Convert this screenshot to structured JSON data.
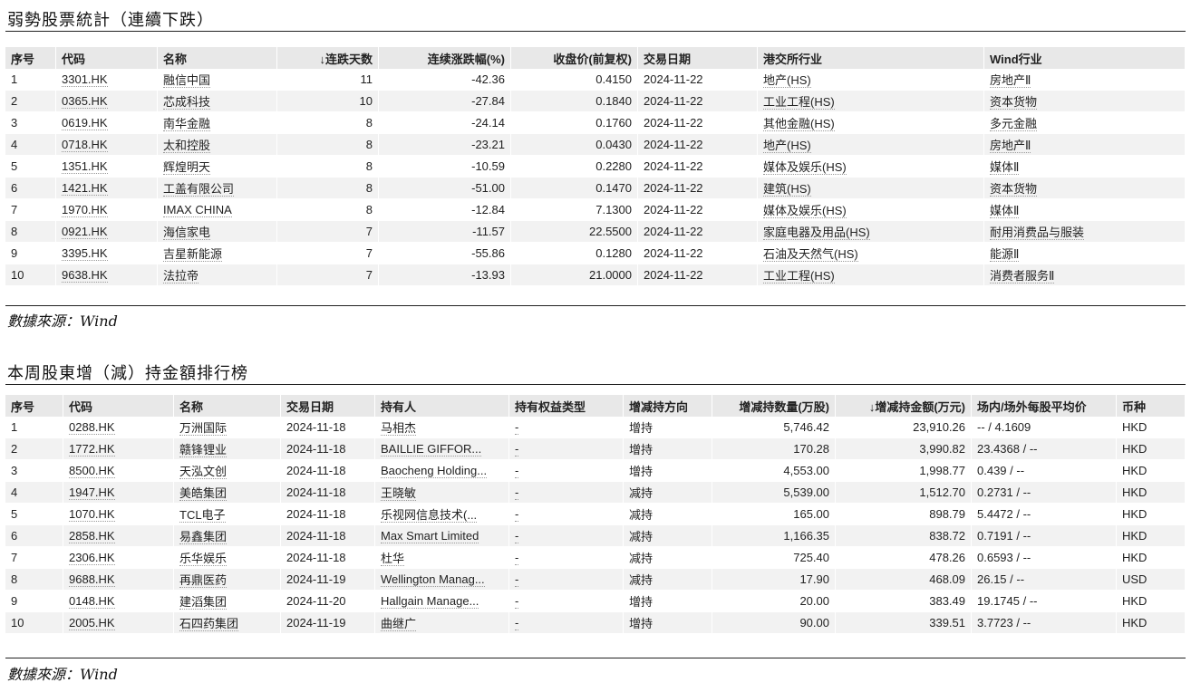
{
  "weak": {
    "title": "弱勢股票統計（連續下跌）",
    "headers": [
      "序号",
      "代码",
      "名称",
      "↓连跌天数",
      "连续涨跌幅(%)",
      "收盘价(前复权)",
      "交易日期",
      "港交所行业",
      "Wind行业"
    ],
    "rows": [
      [
        "1",
        "3301.HK",
        "融信中国",
        "11",
        "-42.36",
        "0.4150",
        "2024-11-22",
        "地产(HS)",
        "房地产Ⅱ"
      ],
      [
        "2",
        "0365.HK",
        "芯成科技",
        "10",
        "-27.84",
        "0.1840",
        "2024-11-22",
        "工业工程(HS)",
        "资本货物"
      ],
      [
        "3",
        "0619.HK",
        "南华金融",
        "8",
        "-24.14",
        "0.1760",
        "2024-11-22",
        "其他金融(HS)",
        "多元金融"
      ],
      [
        "4",
        "0718.HK",
        "太和控股",
        "8",
        "-23.21",
        "0.0430",
        "2024-11-22",
        "地产(HS)",
        "房地产Ⅱ"
      ],
      [
        "5",
        "1351.HK",
        "辉煌明天",
        "8",
        "-10.59",
        "0.2280",
        "2024-11-22",
        "媒体及娱乐(HS)",
        "媒体Ⅱ"
      ],
      [
        "6",
        "1421.HK",
        "工盖有限公司",
        "8",
        "-51.00",
        "0.1470",
        "2024-11-22",
        "建筑(HS)",
        "资本货物"
      ],
      [
        "7",
        "1970.HK",
        "IMAX CHINA",
        "8",
        "-12.84",
        "7.1300",
        "2024-11-22",
        "媒体及娱乐(HS)",
        "媒体Ⅱ"
      ],
      [
        "8",
        "0921.HK",
        "海信家电",
        "7",
        "-11.57",
        "22.5500",
        "2024-11-22",
        "家庭电器及用品(HS)",
        "耐用消费品与服装"
      ],
      [
        "9",
        "3395.HK",
        "吉星新能源",
        "7",
        "-55.86",
        "0.1280",
        "2024-11-22",
        "石油及天然气(HS)",
        "能源Ⅱ"
      ],
      [
        "10",
        "9638.HK",
        "法拉帝",
        "7",
        "-13.93",
        "21.0000",
        "2024-11-22",
        "工业工程(HS)",
        "消费者服务Ⅱ"
      ]
    ],
    "source": "數據來源：Wind"
  },
  "holders": {
    "title": "本周股東增（減）持金額排行榜",
    "headers": [
      "序号",
      "代码",
      "名称",
      "交易日期",
      "持有人",
      "持有权益类型",
      "增减持方向",
      "增减持数量(万股)",
      "↓增减持金额(万元)",
      "场内/场外每股平均价",
      "币种"
    ],
    "rows": [
      [
        "1",
        "0288.HK",
        "万洲国际",
        "2024-11-18",
        "马相杰",
        "-",
        "增持",
        "5,746.42",
        "23,910.26",
        "-- / 4.1609",
        "HKD"
      ],
      [
        "2",
        "1772.HK",
        "赣锋锂业",
        "2024-11-18",
        "BAILLIE GIFFOR...",
        "-",
        "增持",
        "170.28",
        "3,990.82",
        "23.4368 / --",
        "HKD"
      ],
      [
        "3",
        "8500.HK",
        "天泓文创",
        "2024-11-18",
        "Baocheng Holding...",
        "-",
        "增持",
        "4,553.00",
        "1,998.77",
        "0.439 / --",
        "HKD"
      ],
      [
        "4",
        "1947.HK",
        "美皓集团",
        "2024-11-18",
        "王晓敏",
        "-",
        "减持",
        "5,539.00",
        "1,512.70",
        "0.2731 / --",
        "HKD"
      ],
      [
        "5",
        "1070.HK",
        "TCL电子",
        "2024-11-18",
        "乐视网信息技术(...",
        "-",
        "减持",
        "165.00",
        "898.79",
        "5.4472 / --",
        "HKD"
      ],
      [
        "6",
        "2858.HK",
        "易鑫集团",
        "2024-11-18",
        "Max Smart Limited",
        "-",
        "减持",
        "1,166.35",
        "838.72",
        "0.7191 / --",
        "HKD"
      ],
      [
        "7",
        "2306.HK",
        "乐华娱乐",
        "2024-11-18",
        "杜华",
        "-",
        "减持",
        "725.40",
        "478.26",
        "0.6593 / --",
        "HKD"
      ],
      [
        "8",
        "9688.HK",
        "再鼎医药",
        "2024-11-19",
        "Wellington Manag...",
        "-",
        "减持",
        "17.90",
        "468.09",
        "26.15 / --",
        "USD"
      ],
      [
        "9",
        "0148.HK",
        "建滔集团",
        "2024-11-20",
        "Hallgain Manage...",
        "-",
        "增持",
        "20.00",
        "383.49",
        "19.1745 / --",
        "HKD"
      ],
      [
        "10",
        "2005.HK",
        "石四药集团",
        "2024-11-19",
        "曲继广",
        "-",
        "增持",
        "90.00",
        "339.51",
        "3.7723 / --",
        "HKD"
      ]
    ],
    "source": "數據來源：Wind"
  }
}
